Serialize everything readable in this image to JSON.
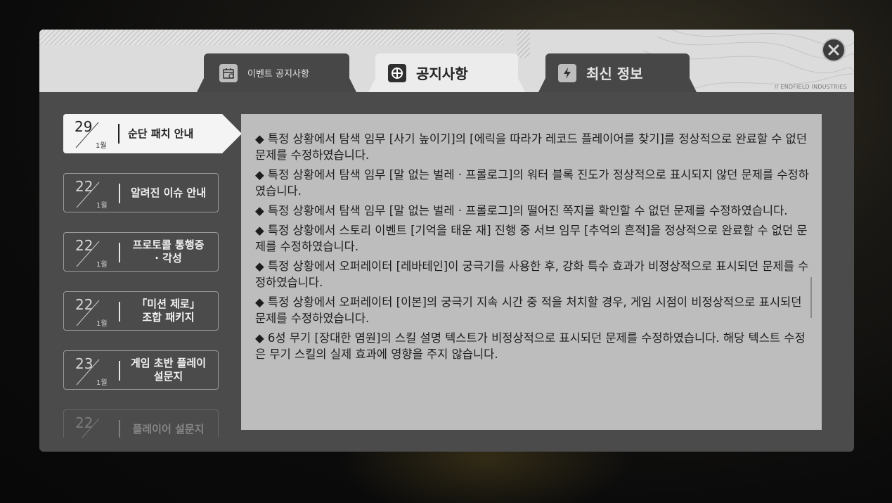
{
  "tabs": [
    {
      "label": "이벤트 공지사항",
      "icon": "calendar-icon",
      "active": false
    },
    {
      "label": "공지사항",
      "icon": "compass-icon",
      "active": true
    },
    {
      "label": "최신 정보",
      "icon": "lightning-icon",
      "active": false
    }
  ],
  "brand": "// ENDFIELD INDUSTRIES",
  "sidebar": {
    "items": [
      {
        "day": "29",
        "month": "1월",
        "title": "순단 패치 안내",
        "active": true
      },
      {
        "day": "22",
        "month": "1월",
        "title": "알려진 이슈 안내",
        "active": false
      },
      {
        "day": "22",
        "month": "1월",
        "title_line1": "프로토콜 통행증",
        "title_line2": "· 각성",
        "active": false
      },
      {
        "day": "22",
        "month": "1월",
        "title_line1": "「미션 제로」",
        "title_line2": "조합 패키지",
        "active": false
      },
      {
        "day": "23",
        "month": "1월",
        "title_line1": "게임 초반 플레이",
        "title_line2": "설문지",
        "active": false
      },
      {
        "day": "22",
        "month": "",
        "title": "플레이어 설문지",
        "active": false
      }
    ]
  },
  "content": {
    "paragraphs": [
      "◆ 특정 상황에서 탐색 임무 [사기 높이기]의 [에릭을 따라가 레코드 플레이어를 찾기]를 정상적으로 완료할 수 없던 문제를 수정하였습니다.",
      "◆ 특정 상황에서 탐색 임무 [말 없는 벌레 · 프롤로그]의 워터 블록 진도가 정상적으로 표시되지 않던 문제를 수정하였습니다.",
      "◆ 특정 상황에서 탐색 임무 [말 없는 벌레 · 프롤로그]의 떨어진 쪽지를 확인할 수 없던 문제를 수정하였습니다.",
      "◆ 특정 상황에서 스토리 이벤트 [기억을 태운 재] 진행 중 서브 임무 [추억의 흔적]을 정상적으로 완료할 수 없던 문제를 수정하였습니다.",
      "◆ 특정 상황에서 오퍼레이터 [레바테인]이 궁극기를 사용한 후, 강화 특수 효과가 비정상적으로 표시되던 문제를 수정하였습니다.",
      "◆ 특정 상황에서 오퍼레이터 [이본]의 궁극기 지속 시간 중 적을 처치할 경우, 게임 시점이 비정상적으로 표시되던 문제를 수정하였습니다.",
      "◆ 6성 무기 [장대한 염원]의 스킬 설명 텍스트가 비정상적으로 표시되던 문제를 수정하였습니다. 해당 텍스트 수정은 무기 스킬의 실제 효과에 영향을 주지 않습니다."
    ]
  }
}
